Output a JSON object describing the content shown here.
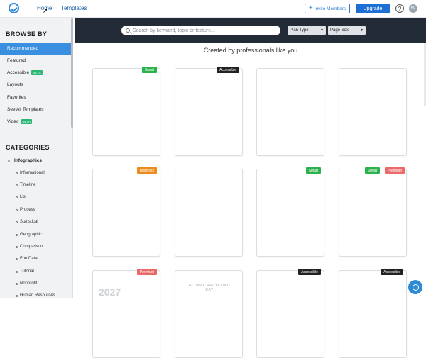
{
  "header": {
    "nav": [
      "Home",
      "Templates"
    ],
    "invite_label": "Invite Members",
    "upgrade_label": "Upgrade",
    "help_glyph": "?",
    "avatar_initials": "BF"
  },
  "sidebar": {
    "browse_heading": "BROWSE BY",
    "browse_items": [
      {
        "label": "Recommended",
        "active": true
      },
      {
        "label": "Featured"
      },
      {
        "label": "Accessible",
        "badge": "BETA"
      },
      {
        "label": "Layouts"
      },
      {
        "label": "Favorites"
      },
      {
        "label": "See All Templates"
      },
      {
        "label": "Video",
        "badge": "BETA"
      }
    ],
    "categories_heading": "CATEGORIES",
    "category_parent": "Infographics",
    "category_children": [
      "Informational",
      "Timeline",
      "List",
      "Process",
      "Statistical",
      "Geographic",
      "Comparison",
      "Fun Data",
      "Tutorial",
      "Nonprofit",
      "Human Resources"
    ]
  },
  "search": {
    "placeholder": "Search by keyword, topic or feature...",
    "plan_type_label": "Plan Type",
    "page_size_label": "Page Size"
  },
  "main": {
    "headline": "Created by professionals like you",
    "cards": [
      {
        "badges": [
          "Smart"
        ]
      },
      {
        "badges": [
          "Accessible"
        ]
      },
      {
        "badges": []
      },
      {
        "badges": []
      },
      {
        "badges": [
          "Business"
        ]
      },
      {
        "badges": []
      },
      {
        "badges": [
          "Smart"
        ]
      },
      {
        "badges": [
          "Smart",
          "Premium"
        ]
      },
      {
        "badges": [
          "Premium"
        ],
        "thumb_text": "2027"
      },
      {
        "badges": [],
        "thumb_text": "GLOBAL RECYCLING DAY"
      },
      {
        "badges": [
          "Accessible"
        ]
      },
      {
        "badges": [
          "Accessible"
        ]
      }
    ]
  },
  "colors": {
    "accent": "#1d6fd6",
    "search_band": "#232b36",
    "smart": "#2bb24c",
    "premium": "#ea6a6a",
    "business": "#ef8b1c",
    "accessible": "#222222"
  }
}
